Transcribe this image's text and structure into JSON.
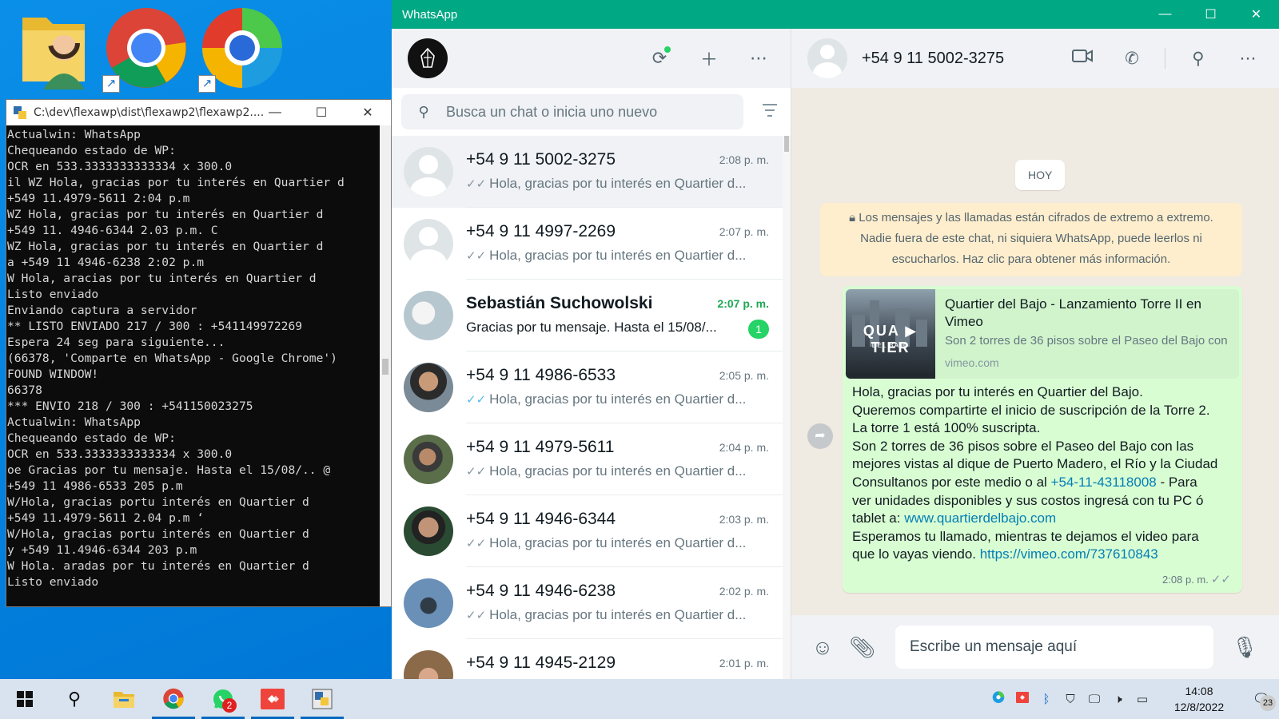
{
  "console": {
    "title": "C:\\dev\\flexawp\\dist\\flexawp2\\flexawp2....",
    "lines": [
      "Actualwin: WhatsApp",
      "Chequeando estado de WP:",
      "OCR en 533.3333333333334 x 300.0",
      "il WZ Hola, gracias por tu interés en Quartier d",
      "+549 11.4979-5611 2:04 p.m",
      "WZ Hola, gracias por tu interés en Quartier d",
      "+549 11. 4946-6344 2.03 p.m. C",
      "WZ Hola, gracias por tu interés en Quartier d",
      "a +549 11 4946-6238 2:02 p.m",
      "W Hola, aracias por tu interés en Quartier d",
      "Listo enviado",
      "Enviando captura a servidor",
      "** LISTO ENVIADO 217 / 300 : +541149972269",
      "Espera 24 seg para siguiente...",
      "(66378, 'Comparte en WhatsApp - Google Chrome')",
      "FOUND WINDOW!",
      "66378",
      "*** ENVIO 218 / 300 : +541150023275",
      "Actualwin: WhatsApp",
      "Chequeando estado de WP:",
      "OCR en 533.3333333333334 x 300.0",
      "oe Gracias por tu mensaje. Hasta el 15/08/.. @",
      "+549 11 4986-6533 205 p.m",
      "W/Hola, gracias portu interés en Quartier d",
      "+549 11.4979-5611 2.04 p.m ‘",
      "W/Hola, gracias portu interés en Quartier d",
      "y +549 11.4946-6344 203 p.m",
      "W Hola. aradas por tu interés en Quartier d",
      "Listo enviado"
    ]
  },
  "whatsapp": {
    "window_title": "WhatsApp",
    "search": {
      "placeholder": "Busca un chat o inicia uno nuevo"
    },
    "chats": [
      {
        "name": "+54 9 11 5002-3275",
        "time": "2:08 p. m.",
        "preview": "Hola, gracias por tu interés en Quartier d...",
        "ticks": "✓✓",
        "read": false,
        "active": true,
        "avatar": "default"
      },
      {
        "name": "+54 9 11 4997-2269",
        "time": "2:07 p. m.",
        "preview": "Hola, gracias por tu interés en Quartier d...",
        "ticks": "✓✓",
        "read": false,
        "active": false,
        "avatar": "default"
      },
      {
        "name": "Sebastián Suchowolski",
        "time": "2:07 p. m.",
        "preview": "Gracias por tu mensaje.  Hasta el 15/08/...",
        "ticks": "",
        "unread": "1",
        "bold": true,
        "avatar": "dove"
      },
      {
        "name": "+54 9 11 4986-6533",
        "time": "2:05 p. m.",
        "preview": "Hola, gracias por tu interés en Quartier d...",
        "ticks": "✓✓",
        "read": true,
        "avatar": "photo1"
      },
      {
        "name": "+54 9 11 4979-5611",
        "time": "2:04 p. m.",
        "preview": "Hola, gracias por tu interés en Quartier d...",
        "ticks": "✓✓",
        "read": false,
        "avatar": "photo2"
      },
      {
        "name": "+54 9 11 4946-6344",
        "time": "2:03 p. m.",
        "preview": "Hola, gracias por tu interés en Quartier d...",
        "ticks": "✓✓",
        "read": false,
        "avatar": "photo3"
      },
      {
        "name": "+54 9 11 4946-6238",
        "time": "2:02 p. m.",
        "preview": "Hola, gracias por tu interés en Quartier d...",
        "ticks": "✓✓",
        "read": false,
        "avatar": "photo4"
      },
      {
        "name": "+54 9 11 4945-2129",
        "time": "2:01 p. m.",
        "preview": "",
        "ticks": "",
        "read": false,
        "avatar": "photo5"
      }
    ],
    "conversation": {
      "contact_name": "+54 9 11 5002-3275",
      "day_label": "HOY",
      "e2e_notice": [
        "Los mensajes y las llamadas están cifrados de extremo a extremo.",
        "Nadie fuera de este chat, ni siquiera WhatsApp, puede leerlos ni",
        "escucharlos. Haz clic para obtener más información."
      ],
      "link_preview": {
        "title": "Quartier del Bajo - Lanzamiento Torre II en Vimeo",
        "description": "Son 2 torres de 36 pisos sobre el Paseo del Bajo con",
        "domain": "vimeo.com",
        "thumb_logo": "QUA ▶ TIER",
        "thumb_sub": "DEL BAJO"
      },
      "message": {
        "line1": "Hola, gracias por tu interés en Quartier del Bajo.",
        "line2": "Queremos compartirte el inicio de suscripción de la Torre 2.",
        "line3": "La torre 1 está 100% suscripta.",
        "line4": "Son 2 torres de 36 pisos sobre el Paseo del Bajo con las",
        "line5": "mejores vistas al dique de Puerto Madero, el Río y la Ciudad",
        "line6a": "Consultanos por este medio o al ",
        "phone_link": "+54-11-43118008",
        "line6b": " - Para",
        "line7": "ver unidades disponibles y sus costos ingresá con tu PC ó",
        "line8a": "tablet a: ",
        "web_link": "www.quartierdelbajo.com",
        "line9": "Esperamos tu llamado, mientras te dejamos el video para",
        "line10a": "que lo vayas viendo. ",
        "video_link": "https://vimeo.com/737610843",
        "time": "2:08 p. m.",
        "ticks": "✓✓"
      },
      "composer_placeholder": "Escribe un mensaje aquí"
    }
  },
  "taskbar": {
    "whatsapp_badge": "2",
    "clock_time": "14:08",
    "clock_date": "12/8/2022",
    "notification_count": "23"
  }
}
